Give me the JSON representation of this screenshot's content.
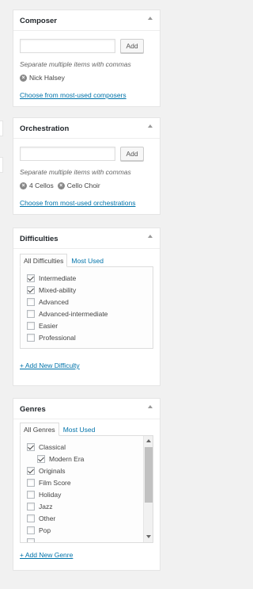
{
  "composer": {
    "title": "Composer",
    "add_label": "Add",
    "help": "Separate multiple items with commas",
    "tags": [
      "Nick Halsey"
    ],
    "link": "Choose from most-used composers"
  },
  "orchestration": {
    "title": "Orchestration",
    "add_label": "Add",
    "help": "Separate multiple items with commas",
    "tags": [
      "4 Cellos",
      "Cello Choir"
    ],
    "link": "Choose from most-used orchestrations"
  },
  "difficulties": {
    "title": "Difficulties",
    "tabs": [
      "All Difficulties",
      "Most Used"
    ],
    "items": [
      {
        "label": "Intermediate",
        "checked": true
      },
      {
        "label": "Mixed-ability",
        "checked": true
      },
      {
        "label": "Advanced",
        "checked": false
      },
      {
        "label": "Advanced-intermediate",
        "checked": false
      },
      {
        "label": "Easier",
        "checked": false
      },
      {
        "label": "Professional",
        "checked": false
      }
    ],
    "add_link": "+ Add New Difficulty"
  },
  "genres": {
    "title": "Genres",
    "tabs": [
      "All Genres",
      "Most Used"
    ],
    "items": [
      {
        "label": "Classical",
        "checked": true,
        "indent": 0
      },
      {
        "label": "Modern Era",
        "checked": true,
        "indent": 1
      },
      {
        "label": "Originals",
        "checked": true,
        "indent": 0
      },
      {
        "label": "Film Score",
        "checked": false,
        "indent": 0
      },
      {
        "label": "Holiday",
        "checked": false,
        "indent": 0
      },
      {
        "label": "Jazz",
        "checked": false,
        "indent": 0
      },
      {
        "label": "Other",
        "checked": false,
        "indent": 0
      },
      {
        "label": "Pop",
        "checked": false,
        "indent": 0
      }
    ],
    "add_link": "+ Add New Genre"
  },
  "colors": {
    "link": "#0073aa",
    "panel_bg": "#ffffff",
    "page_bg": "#f1f1f1"
  }
}
